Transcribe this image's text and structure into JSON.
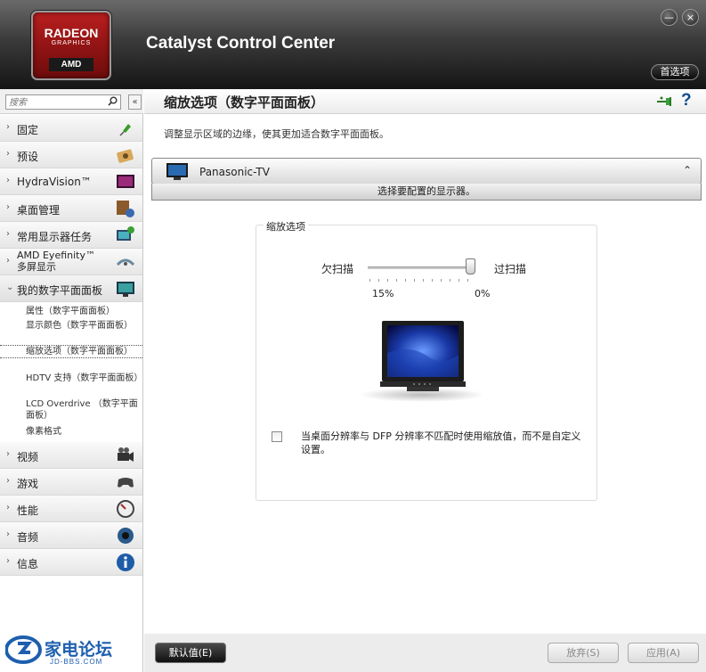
{
  "header": {
    "logo": {
      "line1": "RADEON",
      "line2": "GRAPHICS",
      "brand": "AMD"
    },
    "app_title": "Catalyst Control Center",
    "preferences_label": "首选项",
    "minimize_glyph": "—",
    "close_glyph": "×"
  },
  "sidebar": {
    "search_placeholder": "搜索",
    "collapse_glyph": "«",
    "items": [
      {
        "label": "固定",
        "icon": "pin-icon"
      },
      {
        "label": "预设",
        "icon": "presets-icon"
      },
      {
        "label": "HydraVision™",
        "icon": "hydravision-icon"
      },
      {
        "label": "桌面管理",
        "icon": "desktop-management-icon"
      },
      {
        "label": "常用显示器任务",
        "icon": "display-tasks-icon"
      },
      {
        "label": "AMD Eyefinity™ 多屏显示",
        "line1": "AMD Eyefinity™",
        "line2": "多屏显示",
        "icon": "eyefinity-icon"
      },
      {
        "label": "我的数字平面面板",
        "icon": "flat-panel-icon",
        "expanded": true
      },
      {
        "label": "视频",
        "icon": "video-camera-icon"
      },
      {
        "label": "游戏",
        "icon": "gamepad-icon"
      },
      {
        "label": "性能",
        "icon": "gauge-icon"
      },
      {
        "label": "音频",
        "icon": "speaker-icon"
      },
      {
        "label": "信息",
        "icon": "info-icon"
      }
    ],
    "sub_items": [
      {
        "label": "属性（数字平面面板）"
      },
      {
        "label": "显示颜色（数字平面面板）"
      },
      {
        "label": "缩放选项（数字平面面板）",
        "selected": true
      },
      {
        "label": "HDTV 支持（数字平面面板）"
      },
      {
        "label": "LCD Overdrive （数字平面面板）"
      },
      {
        "label": "像素格式"
      }
    ],
    "watermark": {
      "text": "家电论坛",
      "sub": "JD-BBS.COM"
    }
  },
  "main": {
    "title": "缩放选项（数字平面面板）",
    "description": "调整显示区域的边缘，使其更加适合数字平面面板。",
    "help_glyph": "?",
    "display_select": {
      "value": "Panasonic-TV",
      "hint": "选择要配置的显示器。"
    },
    "scaling": {
      "group_title": "缩放选项",
      "underscan_label": "欠扫描",
      "overscan_label": "过扫描",
      "min_label": "15%",
      "max_label": "0%",
      "slider_value": 0.96,
      "checkbox_checked": false,
      "checkbox_label": "当桌面分辨率与 DFP 分辨率不匹配时使用缩放值，而不是自定义设置。"
    }
  },
  "footer": {
    "defaults_label": "默认值(E)",
    "discard_label": "放弃(S)",
    "apply_label": "应用(A)"
  },
  "colors": {
    "accent_blue": "#0e4e8c",
    "brand_red": "#b91e1e"
  }
}
